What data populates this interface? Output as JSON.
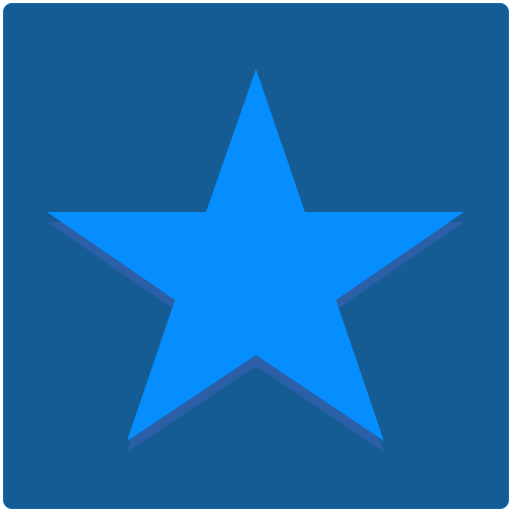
{
  "icon": {
    "name": "star-icon",
    "colors": {
      "background": "#155c95",
      "background_border": "#1b6aa6",
      "star_fill": "#068eff",
      "star_shadow": "#2b5fa8"
    }
  }
}
